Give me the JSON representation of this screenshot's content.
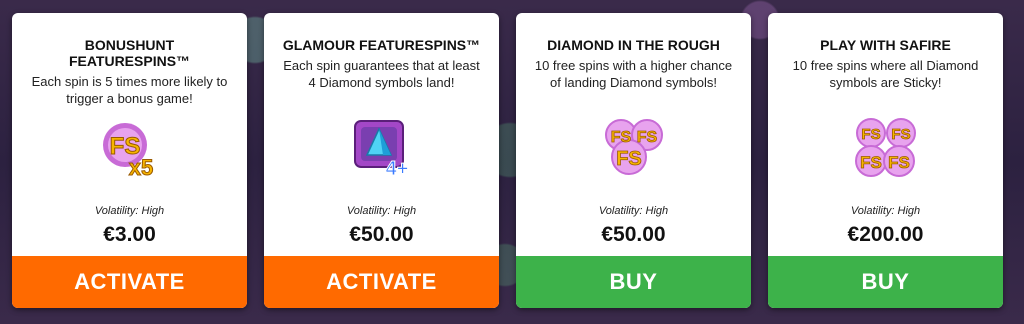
{
  "colors": {
    "activate": "#ff6a00",
    "buy": "#3db24a"
  },
  "cards": [
    {
      "title": "BONUSHUNT FEATURESPINS™",
      "description": "Each spin is 5 times more likely to trigger a bonus game!",
      "icon": "fs-x5-icon",
      "volatility": "Volatility: High",
      "price": "€3.00",
      "button": "ACTIVATE"
    },
    {
      "title": "GLAMOUR FEATURESPINS™",
      "description": "Each spin guarantees that at least 4 Diamond symbols land!",
      "icon": "diamond-4plus-icon",
      "volatility": "Volatility: High",
      "price": "€50.00",
      "button": "ACTIVATE"
    },
    {
      "title": "DIAMOND IN THE ROUGH",
      "description": "10 free spins with a higher chance of landing Diamond symbols!",
      "icon": "fs-triple-icon",
      "volatility": "Volatility: High",
      "price": "€50.00",
      "button": "BUY"
    },
    {
      "title": "PLAY WITH SAFIRE",
      "description": "10 free spins where all Diamond symbols are Sticky!",
      "icon": "fs-quad-icon",
      "volatility": "Volatility: High",
      "price": "€200.00",
      "button": "BUY"
    }
  ]
}
